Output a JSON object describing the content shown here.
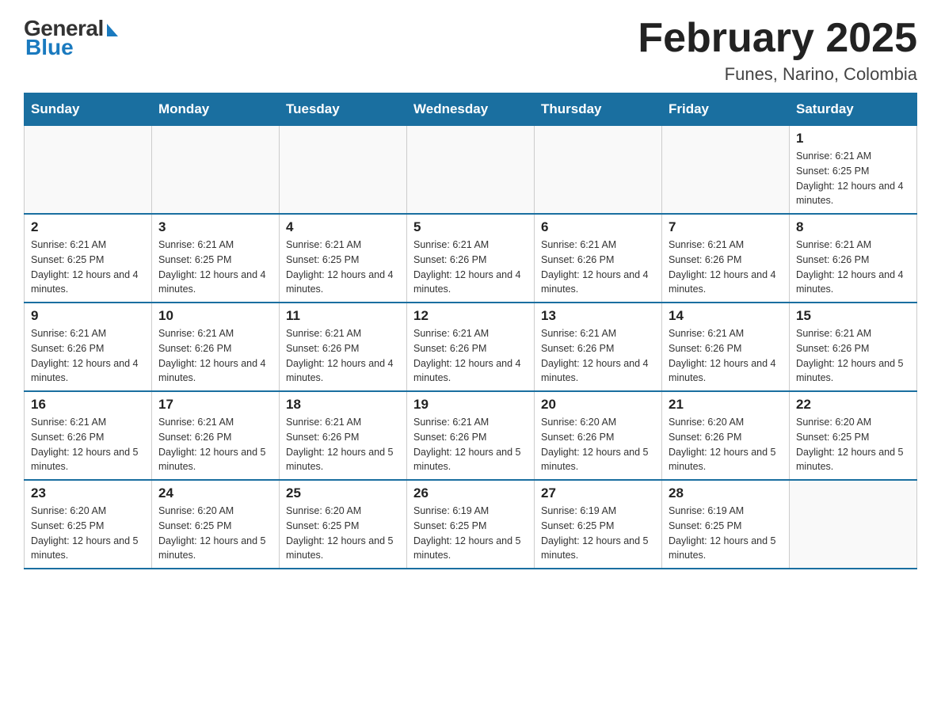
{
  "logo": {
    "general": "General",
    "blue": "Blue"
  },
  "title": "February 2025",
  "location": "Funes, Narino, Colombia",
  "days_of_week": [
    "Sunday",
    "Monday",
    "Tuesday",
    "Wednesday",
    "Thursday",
    "Friday",
    "Saturday"
  ],
  "weeks": [
    [
      {
        "day": "",
        "info": ""
      },
      {
        "day": "",
        "info": ""
      },
      {
        "day": "",
        "info": ""
      },
      {
        "day": "",
        "info": ""
      },
      {
        "day": "",
        "info": ""
      },
      {
        "day": "",
        "info": ""
      },
      {
        "day": "1",
        "info": "Sunrise: 6:21 AM\nSunset: 6:25 PM\nDaylight: 12 hours and 4 minutes."
      }
    ],
    [
      {
        "day": "2",
        "info": "Sunrise: 6:21 AM\nSunset: 6:25 PM\nDaylight: 12 hours and 4 minutes."
      },
      {
        "day": "3",
        "info": "Sunrise: 6:21 AM\nSunset: 6:25 PM\nDaylight: 12 hours and 4 minutes."
      },
      {
        "day": "4",
        "info": "Sunrise: 6:21 AM\nSunset: 6:25 PM\nDaylight: 12 hours and 4 minutes."
      },
      {
        "day": "5",
        "info": "Sunrise: 6:21 AM\nSunset: 6:26 PM\nDaylight: 12 hours and 4 minutes."
      },
      {
        "day": "6",
        "info": "Sunrise: 6:21 AM\nSunset: 6:26 PM\nDaylight: 12 hours and 4 minutes."
      },
      {
        "day": "7",
        "info": "Sunrise: 6:21 AM\nSunset: 6:26 PM\nDaylight: 12 hours and 4 minutes."
      },
      {
        "day": "8",
        "info": "Sunrise: 6:21 AM\nSunset: 6:26 PM\nDaylight: 12 hours and 4 minutes."
      }
    ],
    [
      {
        "day": "9",
        "info": "Sunrise: 6:21 AM\nSunset: 6:26 PM\nDaylight: 12 hours and 4 minutes."
      },
      {
        "day": "10",
        "info": "Sunrise: 6:21 AM\nSunset: 6:26 PM\nDaylight: 12 hours and 4 minutes."
      },
      {
        "day": "11",
        "info": "Sunrise: 6:21 AM\nSunset: 6:26 PM\nDaylight: 12 hours and 4 minutes."
      },
      {
        "day": "12",
        "info": "Sunrise: 6:21 AM\nSunset: 6:26 PM\nDaylight: 12 hours and 4 minutes."
      },
      {
        "day": "13",
        "info": "Sunrise: 6:21 AM\nSunset: 6:26 PM\nDaylight: 12 hours and 4 minutes."
      },
      {
        "day": "14",
        "info": "Sunrise: 6:21 AM\nSunset: 6:26 PM\nDaylight: 12 hours and 4 minutes."
      },
      {
        "day": "15",
        "info": "Sunrise: 6:21 AM\nSunset: 6:26 PM\nDaylight: 12 hours and 5 minutes."
      }
    ],
    [
      {
        "day": "16",
        "info": "Sunrise: 6:21 AM\nSunset: 6:26 PM\nDaylight: 12 hours and 5 minutes."
      },
      {
        "day": "17",
        "info": "Sunrise: 6:21 AM\nSunset: 6:26 PM\nDaylight: 12 hours and 5 minutes."
      },
      {
        "day": "18",
        "info": "Sunrise: 6:21 AM\nSunset: 6:26 PM\nDaylight: 12 hours and 5 minutes."
      },
      {
        "day": "19",
        "info": "Sunrise: 6:21 AM\nSunset: 6:26 PM\nDaylight: 12 hours and 5 minutes."
      },
      {
        "day": "20",
        "info": "Sunrise: 6:20 AM\nSunset: 6:26 PM\nDaylight: 12 hours and 5 minutes."
      },
      {
        "day": "21",
        "info": "Sunrise: 6:20 AM\nSunset: 6:26 PM\nDaylight: 12 hours and 5 minutes."
      },
      {
        "day": "22",
        "info": "Sunrise: 6:20 AM\nSunset: 6:25 PM\nDaylight: 12 hours and 5 minutes."
      }
    ],
    [
      {
        "day": "23",
        "info": "Sunrise: 6:20 AM\nSunset: 6:25 PM\nDaylight: 12 hours and 5 minutes."
      },
      {
        "day": "24",
        "info": "Sunrise: 6:20 AM\nSunset: 6:25 PM\nDaylight: 12 hours and 5 minutes."
      },
      {
        "day": "25",
        "info": "Sunrise: 6:20 AM\nSunset: 6:25 PM\nDaylight: 12 hours and 5 minutes."
      },
      {
        "day": "26",
        "info": "Sunrise: 6:19 AM\nSunset: 6:25 PM\nDaylight: 12 hours and 5 minutes."
      },
      {
        "day": "27",
        "info": "Sunrise: 6:19 AM\nSunset: 6:25 PM\nDaylight: 12 hours and 5 minutes."
      },
      {
        "day": "28",
        "info": "Sunrise: 6:19 AM\nSunset: 6:25 PM\nDaylight: 12 hours and 5 minutes."
      },
      {
        "day": "",
        "info": ""
      }
    ]
  ]
}
